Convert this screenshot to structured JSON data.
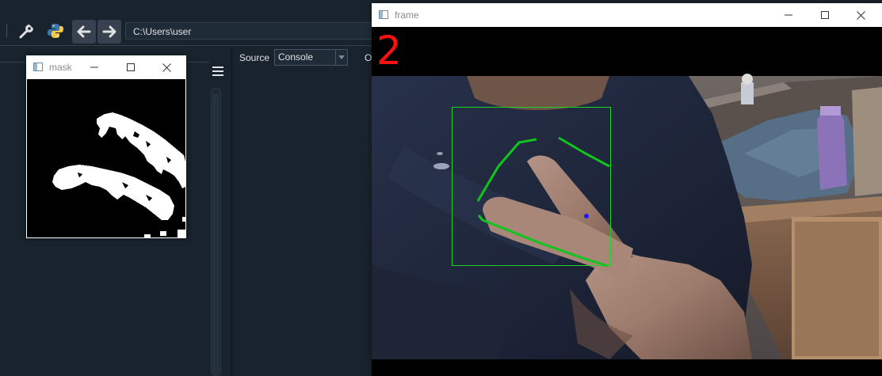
{
  "toolbar": {
    "path": "C:\\Users\\user",
    "icons": [
      "wrench-icon",
      "python-icon",
      "arrow-left-icon",
      "arrow-right-icon"
    ]
  },
  "console_pane": {
    "source_label": "Source",
    "source_value": "Console",
    "truncated_label": "O"
  },
  "mask_window": {
    "title": "mask"
  },
  "frame_window": {
    "title": "frame",
    "finger_count": "2",
    "colors": {
      "count": "#ff1010",
      "bounding_box": "#1fd12a",
      "hull": "#12c41e",
      "centroid": "#1a1aff"
    }
  },
  "window_controls": [
    "minimize-icon",
    "maximize-icon",
    "close-icon"
  ]
}
